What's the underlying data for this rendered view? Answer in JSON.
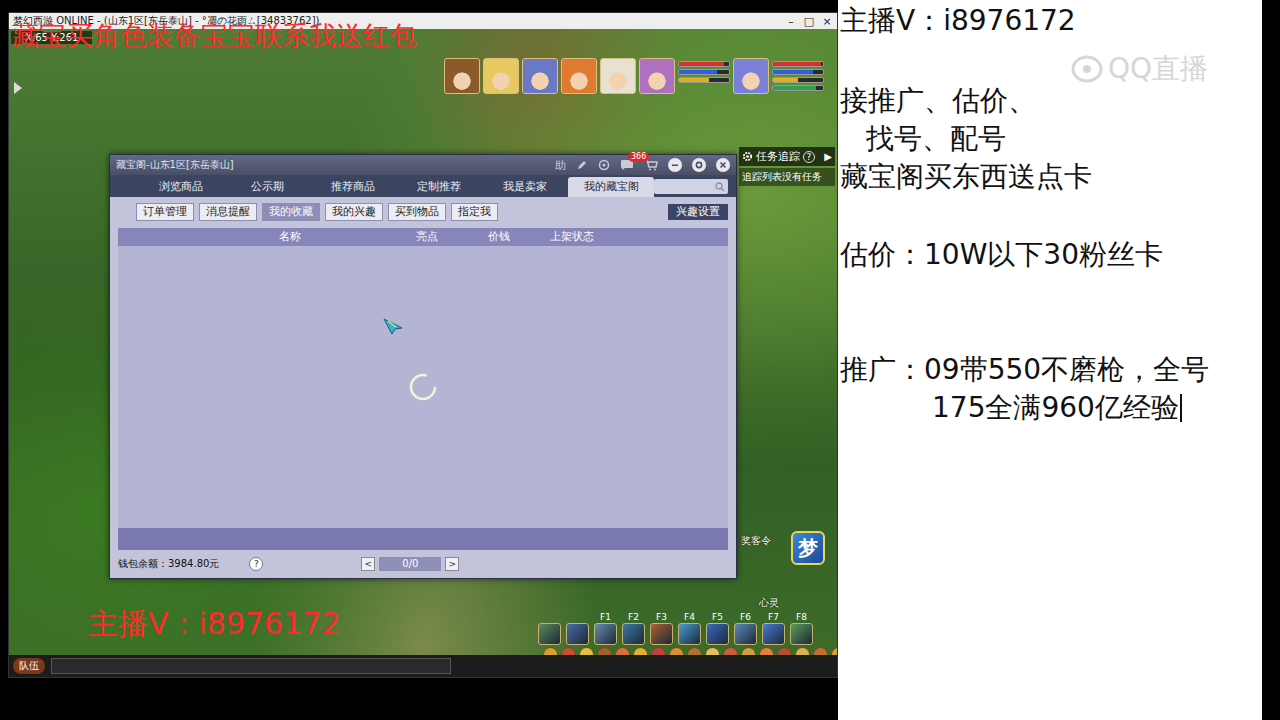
{
  "overlays": {
    "banner": "藏宝买角色装备宝宝联系我送红包",
    "contact": "主播V：i8976172"
  },
  "game_window": {
    "title": "梦幻西游 ONLINE - (山东1区[东岳泰山] - °凋の花雨ㄙ[34833762])",
    "controls": [
      "–",
      "□",
      "×"
    ],
    "coords": "X:65 Y:261"
  },
  "party": [
    {
      "color": "#8b5a2b"
    },
    {
      "color": "#e8c860"
    },
    {
      "color": "#6a78c8"
    },
    {
      "color": "#e07a30"
    },
    {
      "color": "#e8e0d0"
    },
    {
      "color": "#b070c0"
    },
    {
      "color": "#7a80d8"
    }
  ],
  "pet_bars": [
    {
      "level": 0.9,
      "color": "#d83030"
    },
    {
      "level": 0.75,
      "color": "#3060d8"
    },
    {
      "level": 0.6,
      "color": "#d8b020"
    }
  ],
  "player_bars": [
    {
      "level": 0.95,
      "color": "#d83030"
    },
    {
      "level": 0.8,
      "color": "#3060d8"
    },
    {
      "level": 0.5,
      "color": "#e0b020"
    },
    {
      "level": 0.85,
      "color": "#30a050"
    }
  ],
  "task_tracker": {
    "title": "任务追踪",
    "help": "?",
    "arrow": "▶",
    "empty": "追踪列表没有任务"
  },
  "cbg_window": {
    "title": "藏宝阁-山东1区[东岳泰山]",
    "help": "助",
    "badge": "366",
    "tabs": [
      {
        "label": "浏览商品",
        "selected": false
      },
      {
        "label": "公示期",
        "selected": false
      },
      {
        "label": "推荐商品",
        "selected": false
      },
      {
        "label": "定制推荐",
        "selected": false
      },
      {
        "label": "我是卖家",
        "selected": false
      },
      {
        "label": "我的藏宝阁",
        "selected": true
      }
    ],
    "subtabs": [
      {
        "label": "订单管理",
        "selected": false
      },
      {
        "label": "消息提醒",
        "selected": false
      },
      {
        "label": "我的收藏",
        "selected": true
      },
      {
        "label": "我的兴趣",
        "selected": false
      },
      {
        "label": "买到物品",
        "selected": false
      },
      {
        "label": "指定我",
        "selected": false
      }
    ],
    "interest_button": "兴趣设置",
    "columns": [
      "名称",
      "亮点",
      "价钱",
      "上架状态"
    ],
    "rows": [],
    "loading": true,
    "wallet": "钱包余额：3984.80元",
    "wallet_help": "?",
    "pager": {
      "prev": "<",
      "page": "0/0",
      "next": ">"
    }
  },
  "side_labels": [
    "奖客令",
    "心灵"
  ],
  "dream_badge": "梦",
  "hotkeys": [
    "F1",
    "F2",
    "F3",
    "F4",
    "F5",
    "F6",
    "F7",
    "F8"
  ],
  "chat": {
    "channel": "队伍"
  },
  "stream_panel": {
    "contact": "主播V：i8976172",
    "services": [
      "接推广、估价、",
      "找号、配号"
    ],
    "perk": "藏宝阁买东西送点卡",
    "appraisal": "估价：10W以下30粉丝卡",
    "promotion": [
      "推广：09带550不磨枪，全号",
      "175全满960亿经验"
    ]
  },
  "watermark": "QQ直播"
}
